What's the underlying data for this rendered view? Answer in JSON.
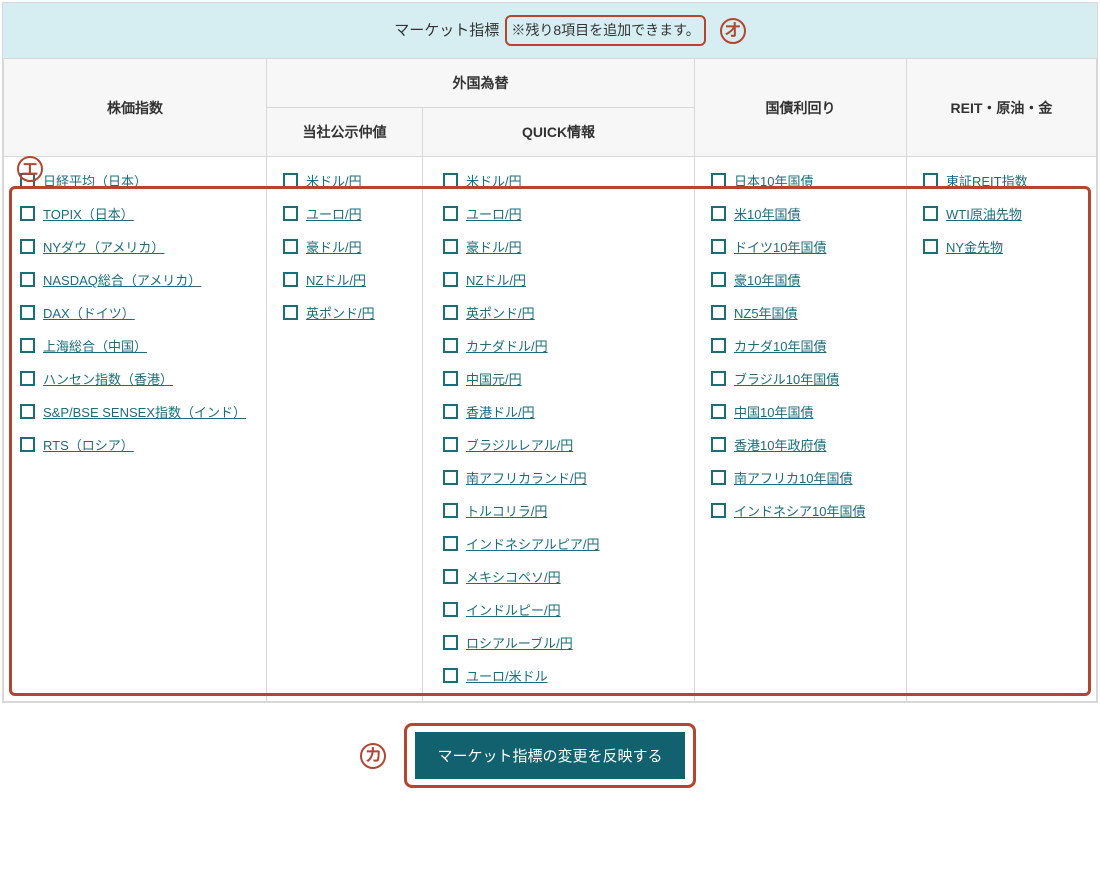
{
  "header": {
    "title": "マーケット指標",
    "note": "※残り8項目を追加できます。"
  },
  "callouts": {
    "o": "オ",
    "e": "エ",
    "ka": "カ"
  },
  "columns": {
    "stock": "株価指数",
    "fx_group": "外国為替",
    "fx1": "当社公示仲値",
    "fx2": "QUICK情報",
    "bond": "国債利回り",
    "reit": "REIT・原油・金"
  },
  "items": {
    "stock": [
      "日経平均（日本）",
      "TOPIX（日本）",
      "NYダウ（アメリカ）",
      "NASDAQ総合（アメリカ）",
      "DAX（ドイツ）",
      "上海総合（中国）",
      "ハンセン指数（香港）",
      "S&P/BSE SENSEX指数（インド）",
      "RTS（ロシア）"
    ],
    "fx1": [
      "米ドル/円",
      "ユーロ/円",
      "豪ドル/円",
      "NZドル/円",
      "英ポンド/円"
    ],
    "fx2": [
      "米ドル/円",
      "ユーロ/円",
      "豪ドル/円",
      "NZドル/円",
      "英ポンド/円",
      "カナダドル/円",
      "中国元/円",
      "香港ドル/円",
      "ブラジルレアル/円",
      "南アフリカランド/円",
      "トルコリラ/円",
      "インドネシアルピア/円",
      "メキシコペソ/円",
      "インドルピー/円",
      "ロシアルーブル/円",
      "ユーロ/米ドル"
    ],
    "bond": [
      "日本10年国債",
      "米10年国債",
      "ドイツ10年国債",
      "豪10年国債",
      "NZ5年国債",
      "カナダ10年国債",
      "ブラジル10年国債",
      "中国10年国債",
      "香港10年政府債",
      "南アフリカ10年国債",
      "インドネシア10年国債"
    ],
    "reit": [
      "東証REIT指数",
      "WTI原油先物",
      "NY金先物"
    ]
  },
  "submit": {
    "label": "マーケット指標の変更を反映する"
  }
}
